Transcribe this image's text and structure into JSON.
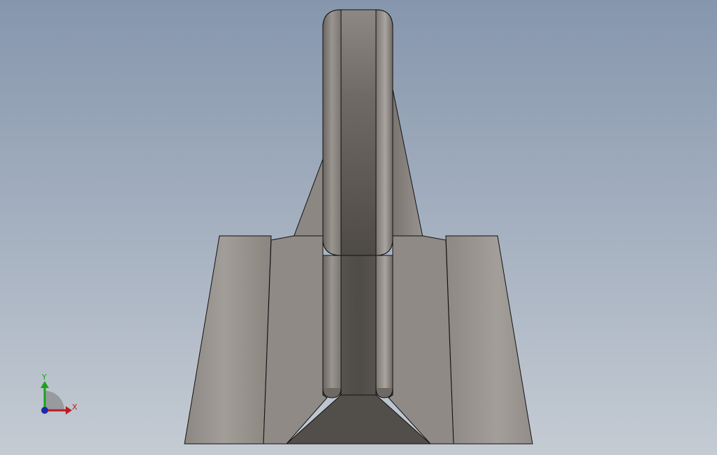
{
  "viewport": {
    "background_top": "#8696ad",
    "background_bottom": "#c4cbd3"
  },
  "model": {
    "face_light": "#a09b96",
    "face_mid": "#8f8a84",
    "face_dark": "#4f4b47",
    "edge": "#111111"
  },
  "triad": {
    "x_label": "X",
    "y_label": "Y",
    "x_color": "#c0191d",
    "y_color": "#1aa31a",
    "z_color": "#1d2aa8"
  }
}
